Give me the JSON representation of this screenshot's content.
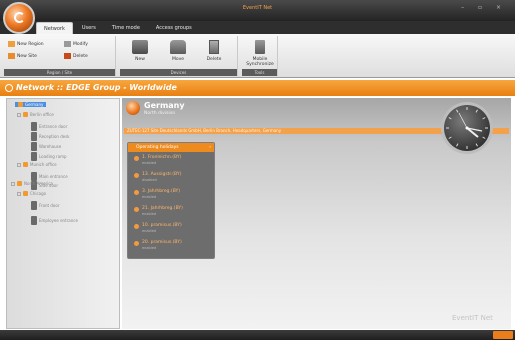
{
  "window": {
    "title": "EventIT Net",
    "controls": "–  ▫  ×"
  },
  "tabs": [
    {
      "label": "Network"
    },
    {
      "label": "Users"
    },
    {
      "label": "Time mode"
    },
    {
      "label": "Access groups"
    }
  ],
  "ribbon": {
    "group1": {
      "label": "Region / Site",
      "buttons": [
        {
          "label": "New Region"
        },
        {
          "label": "Modify"
        },
        {
          "label": "New Site"
        },
        {
          "label": "Delete"
        }
      ]
    },
    "group2": {
      "label": "Devices",
      "buttons": [
        {
          "label": "New"
        },
        {
          "label": "Move"
        },
        {
          "label": "Delete"
        }
      ]
    },
    "group3": {
      "label": "Tools",
      "buttons": [
        {
          "label": "Mobile Synchronize"
        }
      ]
    }
  },
  "header": {
    "title": "Network :: EDGE Group - Worldwide"
  },
  "tree": {
    "items": [
      {
        "label": "Germany"
      },
      {
        "label": "Berlin office"
      },
      {
        "label": "Entrance door"
      },
      {
        "label": "Reception desk"
      },
      {
        "label": "Warehouse"
      },
      {
        "label": "Loading ramp"
      },
      {
        "label": "Munich office"
      },
      {
        "label": "Main entrance"
      },
      {
        "label": "Side door"
      },
      {
        "label": "North America"
      },
      {
        "label": "Chicago"
      },
      {
        "label": "Front door"
      },
      {
        "label": "Employee entrance"
      }
    ]
  },
  "content": {
    "title": "Germany",
    "subtitle": "North division",
    "info_line": "ZUTEC-127 Site Deutschlands GmbH, Berlin Branch, Headquarters, Germany"
  },
  "panel": {
    "title": "Operating holidays",
    "rows": [
      {
        "name": "1. Fronleichn.(BY)",
        "status": "enabled"
      },
      {
        "name": "13. Aussigstr.(BY)",
        "status": "disabled"
      },
      {
        "name": "3. Jahrhbreg.(BY)",
        "status": "enabled"
      },
      {
        "name": "21. Jahrhbreg.(BY)",
        "status": "enabled"
      },
      {
        "name": "10. pramisus.(BY)",
        "status": "enabled"
      },
      {
        "name": "20. pramisus.(BY)",
        "status": "enabled"
      }
    ]
  },
  "watermark": "EventIT Net",
  "colors": {
    "accent": "#ee8b1e",
    "titlebar": "#2b2b2b",
    "selection": "#4a8fe0"
  }
}
